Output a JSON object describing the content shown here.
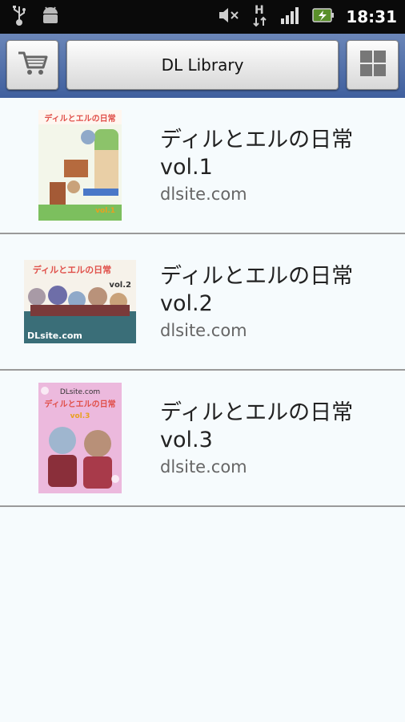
{
  "status_bar": {
    "time": "18:31",
    "icons": [
      "usb-icon",
      "android-debug-icon",
      "mute-icon",
      "hsdpa-icon",
      "signal-icon",
      "battery-charging-icon"
    ],
    "network_label": "H"
  },
  "toolbar": {
    "title": "DL Library",
    "left_icon": "cart-icon",
    "right_icon": "grid-view-icon"
  },
  "items": [
    {
      "title": "ディルとエルの日常 vol.1",
      "subtitle": "dlsite.com",
      "cover_text": "ディルとエルの日常",
      "cover_badge": "vol.1"
    },
    {
      "title": "ディルとエルの日常 vol.2",
      "subtitle": "dlsite.com",
      "cover_text": "ディルとエルの日常",
      "cover_badge": "vol.2",
      "cover_footer": "DLsite.com"
    },
    {
      "title": "ディルとエルの日常 vol.3",
      "subtitle": "dlsite.com",
      "cover_text": "ディルとエルの日常",
      "cover_badge": "vol.3",
      "cover_header": "DLsite.com"
    }
  ]
}
